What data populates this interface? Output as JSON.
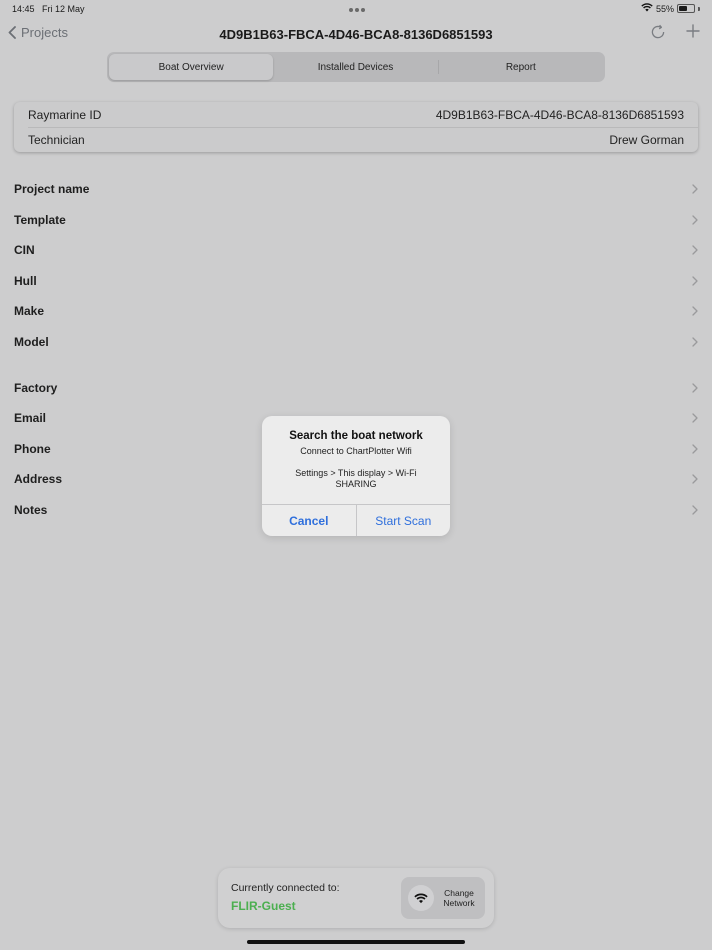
{
  "status_bar": {
    "time": "14:45",
    "date": "Fri 12 May",
    "battery_text": "55%",
    "battery_level": 0.55
  },
  "nav": {
    "back_label": "Projects",
    "title": "4D9B1B63-FBCA-4D46-BCA8-8136D6851593"
  },
  "tabs": [
    {
      "label": "Boat Overview",
      "selected": true
    },
    {
      "label": "Installed Devices",
      "selected": false
    },
    {
      "label": "Report",
      "selected": false
    }
  ],
  "info": {
    "rows": [
      {
        "label": "Raymarine ID",
        "value": "4D9B1B63-FBCA-4D46-BCA8-8136D6851593"
      },
      {
        "label": "Technician",
        "value": "Drew Gorman"
      }
    ]
  },
  "fields": [
    "Project name",
    "Template",
    "CIN",
    "Hull",
    "Make",
    "Model",
    "Factory",
    "Email",
    "Phone",
    "Address",
    "Notes"
  ],
  "alert": {
    "title": "Search the boat network",
    "message_line1": "Connect to ChartPlotter Wifi",
    "message_line2": "Settings > This display > Wi-Fi SHARING",
    "cancel_label": "Cancel",
    "confirm_label": "Start Scan"
  },
  "network": {
    "label": "Currently connected to:",
    "name": "FLIR-Guest",
    "change_label": "Change Network"
  },
  "colors": {
    "link": "#2f6fdc",
    "connected": "#4caf50",
    "background": "#cdcdce"
  },
  "icons": [
    "chevron-left-icon",
    "refresh-icon",
    "plus-icon",
    "chevron-right-icon",
    "wifi-icon",
    "battery-icon"
  ]
}
